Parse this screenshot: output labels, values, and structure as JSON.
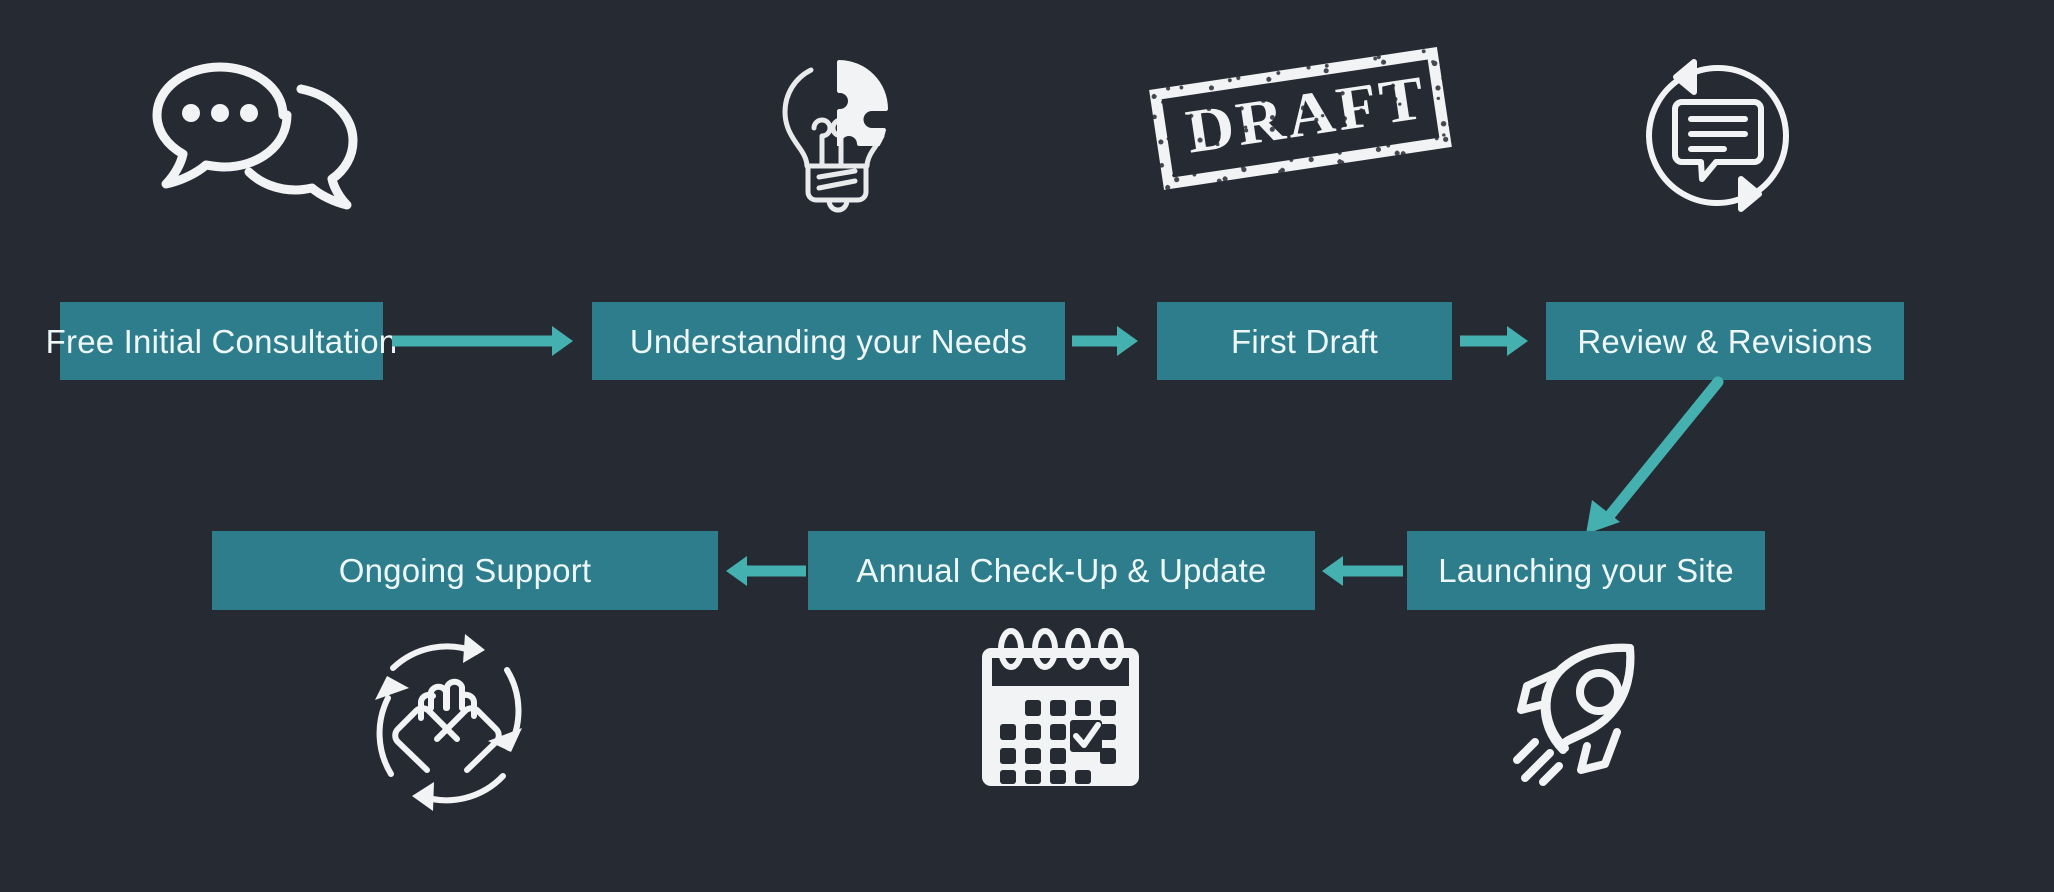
{
  "page": {
    "title": "Website Design Process Flow",
    "background_color": "#262a33",
    "box_color": "#2e7d8c",
    "arrow_color": "#45b0b0",
    "text_color": "#eef7f8",
    "icon_color": "#f2f3f4"
  },
  "flow": {
    "row1": [
      {
        "id": "free-initial-consultation",
        "label": "Free Initial Consultation",
        "icon": "chat-bubbles-icon",
        "icon_position": "above"
      },
      {
        "id": "understanding-your-needs",
        "label": "Understanding your Needs",
        "icon": "lightbulb-puzzle-icon",
        "icon_position": "above"
      },
      {
        "id": "first-draft",
        "label": "First Draft",
        "icon": "draft-stamp-icon",
        "icon_position": "above",
        "icon_text": "DRAFT"
      },
      {
        "id": "review-and-revisions",
        "label": "Review & Revisions",
        "icon": "feedback-loop-icon",
        "icon_position": "above"
      }
    ],
    "row2": [
      {
        "id": "ongoing-support",
        "label": "Ongoing Support",
        "icon": "handshake-cycle-icon",
        "icon_position": "below"
      },
      {
        "id": "annual-check-up-and-update",
        "label": "Annual Check-Up & Update",
        "icon": "calendar-check-icon",
        "icon_position": "below"
      },
      {
        "id": "launching-your-site",
        "label": "Launching your Site",
        "icon": "rocket-icon",
        "icon_position": "below"
      }
    ],
    "connectors": [
      {
        "id": "arrow-consultation-to-needs",
        "direction": "right"
      },
      {
        "id": "arrow-needs-to-draft",
        "direction": "right"
      },
      {
        "id": "arrow-draft-to-review",
        "direction": "right"
      },
      {
        "id": "arrow-review-to-launch",
        "direction": "diagonal-down-left"
      },
      {
        "id": "arrow-launch-to-checkup",
        "direction": "left"
      },
      {
        "id": "arrow-checkup-to-support",
        "direction": "left"
      }
    ]
  }
}
